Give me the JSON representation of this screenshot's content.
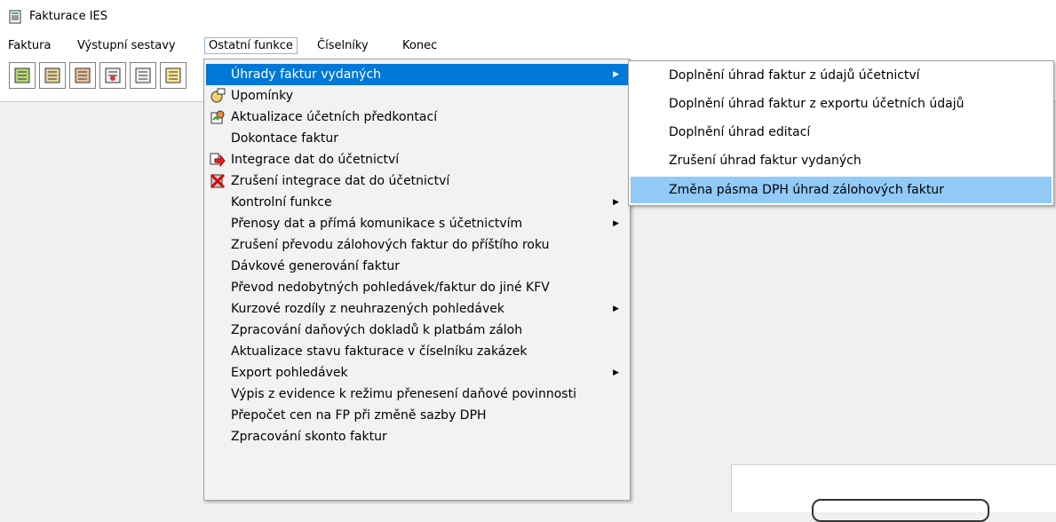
{
  "app": {
    "title": "Fakturace IES"
  },
  "menubar": {
    "items": [
      {
        "label": "Faktura"
      },
      {
        "label": "Výstupní sestavy"
      },
      {
        "label": "Ostatní funkce"
      },
      {
        "label": "Číselníky"
      },
      {
        "label": "Konec"
      }
    ]
  },
  "main_menu": {
    "items": [
      {
        "label": "Úhrady faktur vydaných"
      },
      {
        "label": "Upomínky"
      },
      {
        "label": "Aktualizace účetních předkontací"
      },
      {
        "label": "Dokontace faktur"
      },
      {
        "label": "Integrace dat do účetnictví"
      },
      {
        "label": "Zrušení integrace dat do účetnictví"
      },
      {
        "label": "Kontrolní funkce"
      },
      {
        "label": "Přenosy dat a přímá komunikace s účetnictvím"
      },
      {
        "label": "Zrušení převodu zálohových faktur do příštího roku"
      },
      {
        "label": "Dávkové generování faktur"
      },
      {
        "label": "Převod nedobytných pohledávek/faktur do jiné KFV"
      },
      {
        "label": "Kurzové rozdíly z neuhrazených pohledávek"
      },
      {
        "label": "Zpracování daňových dokladů k platbám záloh"
      },
      {
        "label": "Aktualizace stavu fakturace v číselníku zakázek"
      },
      {
        "label": "Export pohledávek"
      },
      {
        "label": "Výpis z evidence k režimu přenesení daňové povinnosti"
      },
      {
        "label": "Přepočet cen na FP při změně sazby DPH"
      },
      {
        "label": "Zpracování skonto faktur"
      }
    ]
  },
  "sub_menu": {
    "items": [
      {
        "label": "Doplnění úhrad faktur z údajů účetnictví"
      },
      {
        "label": "Doplnění úhrad faktur z exportu účetních údajů"
      },
      {
        "label": "Doplnění úhrad editací"
      },
      {
        "label": "Zrušení úhrad faktur vydaných"
      },
      {
        "label": "Změna pásma DPH úhrad zálohových faktur"
      }
    ]
  }
}
